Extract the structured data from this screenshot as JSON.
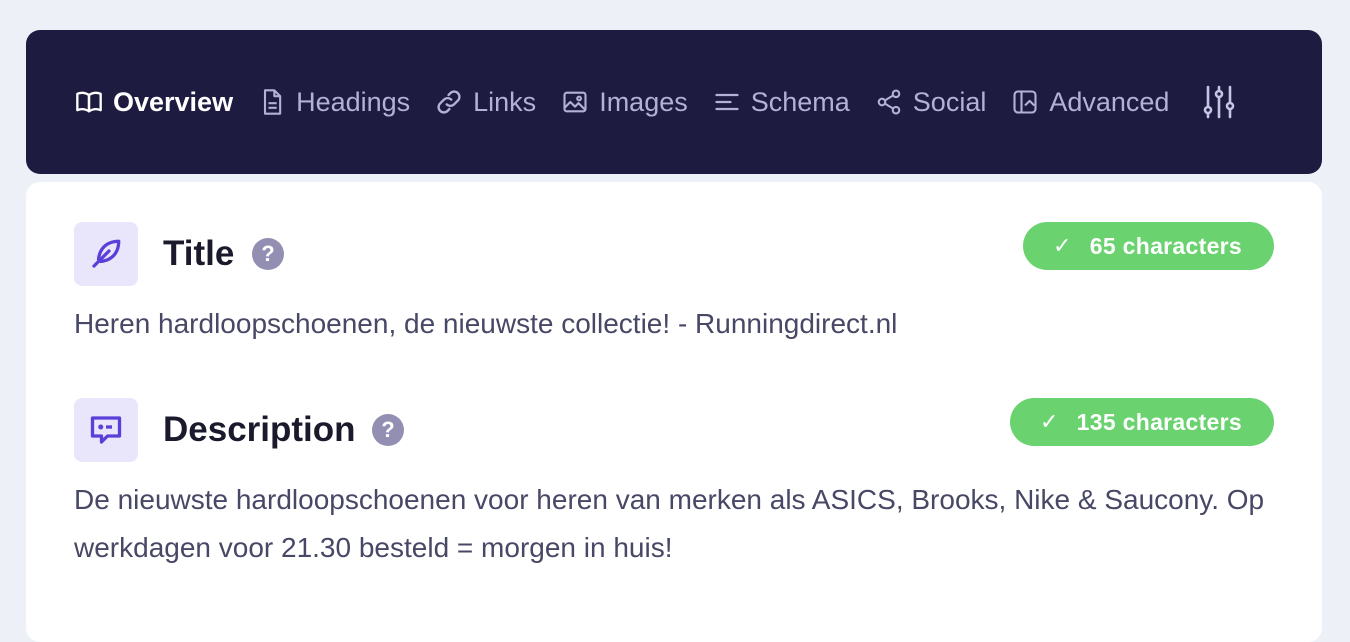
{
  "nav": {
    "items": [
      {
        "label": "Overview",
        "icon": "book-open-icon"
      },
      {
        "label": "Headings",
        "icon": "document-icon"
      },
      {
        "label": "Links",
        "icon": "link-icon"
      },
      {
        "label": "Images",
        "icon": "image-icon"
      },
      {
        "label": "Schema",
        "icon": "align-left-icon"
      },
      {
        "label": "Social",
        "icon": "share-icon"
      },
      {
        "label": "Advanced",
        "icon": "advanced-icon"
      }
    ],
    "settings_icon": "sliders-icon"
  },
  "title_section": {
    "label": "Title",
    "help": "?",
    "badge_check": "✓",
    "badge_text": "65 characters",
    "text": "Heren hardloopschoenen, de nieuwste collectie! - Runningdirect.nl"
  },
  "description_section": {
    "label": "Description",
    "help": "?",
    "badge_check": "✓",
    "badge_text": "135 characters",
    "text": "De nieuwste hardloopschoenen voor heren van merken als ASICS, Brooks, Nike & Saucony. Op werkdagen voor 21.30 besteld = morgen in huis!"
  },
  "colors": {
    "navbar_bg": "#1d1c40",
    "badge_ok": "#6ad36f",
    "icon_accent": "#5b3fd9"
  }
}
